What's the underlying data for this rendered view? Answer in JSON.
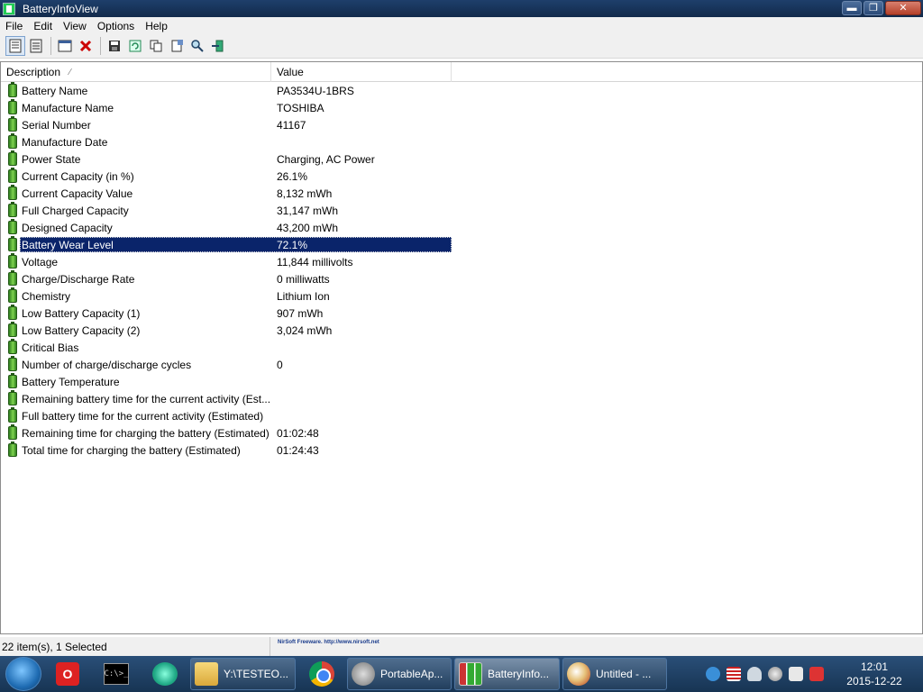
{
  "window": {
    "title": "BatteryInfoView",
    "minimize": "▬",
    "restore": "❐",
    "close": "✕"
  },
  "menu": [
    "File",
    "Edit",
    "View",
    "Options",
    "Help"
  ],
  "list": {
    "columns": {
      "description": "Description",
      "value": "Value"
    },
    "rows": [
      {
        "description": "Battery Name",
        "value": "PA3534U-1BRS"
      },
      {
        "description": "Manufacture Name",
        "value": "TOSHIBA"
      },
      {
        "description": "Serial Number",
        "value": "41167"
      },
      {
        "description": "Manufacture Date",
        "value": ""
      },
      {
        "description": "Power State",
        "value": "Charging, AC Power"
      },
      {
        "description": "Current Capacity (in %)",
        "value": "26.1%"
      },
      {
        "description": "Current Capacity Value",
        "value": "8,132 mWh"
      },
      {
        "description": "Full Charged Capacity",
        "value": "31,147 mWh"
      },
      {
        "description": "Designed Capacity",
        "value": "43,200 mWh"
      },
      {
        "description": "Battery Wear Level",
        "value": "72.1%",
        "selected": true
      },
      {
        "description": "Voltage",
        "value": "11,844 millivolts"
      },
      {
        "description": "Charge/Discharge Rate",
        "value": "0 milliwatts"
      },
      {
        "description": "Chemistry",
        "value": "Lithium Ion"
      },
      {
        "description": "Low Battery Capacity (1)",
        "value": "907 mWh"
      },
      {
        "description": "Low Battery Capacity (2)",
        "value": "3,024 mWh"
      },
      {
        "description": "Critical Bias",
        "value": ""
      },
      {
        "description": "Number of charge/discharge cycles",
        "value": "0"
      },
      {
        "description": "Battery Temperature",
        "value": ""
      },
      {
        "description": "Remaining battery time for the current activity (Est...",
        "value": ""
      },
      {
        "description": "Full battery time for the current activity (Estimated)",
        "value": ""
      },
      {
        "description": "Remaining time for charging the battery (Estimated)",
        "value": "01:02:48"
      },
      {
        "description": "Total  time for charging the battery (Estimated)",
        "value": "01:24:43"
      }
    ]
  },
  "status": {
    "count": "22 item(s), 1 Selected",
    "link": "NirSoft Freeware.  http://www.nirsoft.net"
  },
  "taskbar": {
    "tasks": [
      {
        "label": "Y:\\TESTEO...",
        "icon": "folder-icon"
      },
      {
        "label": "PortableAp...",
        "icon": "portableapps-icon"
      },
      {
        "label": "BatteryInfo...",
        "icon": "battery-icon",
        "active": true
      },
      {
        "label": "Untitled - ...",
        "icon": "paint-icon"
      }
    ],
    "cmd_text": "C:\\>_",
    "time": "12:01",
    "date": "2015-12-22"
  },
  "colors": {
    "title_bar": "#1a3760",
    "selection": "#0a246a",
    "taskbar": "#1f4066"
  }
}
